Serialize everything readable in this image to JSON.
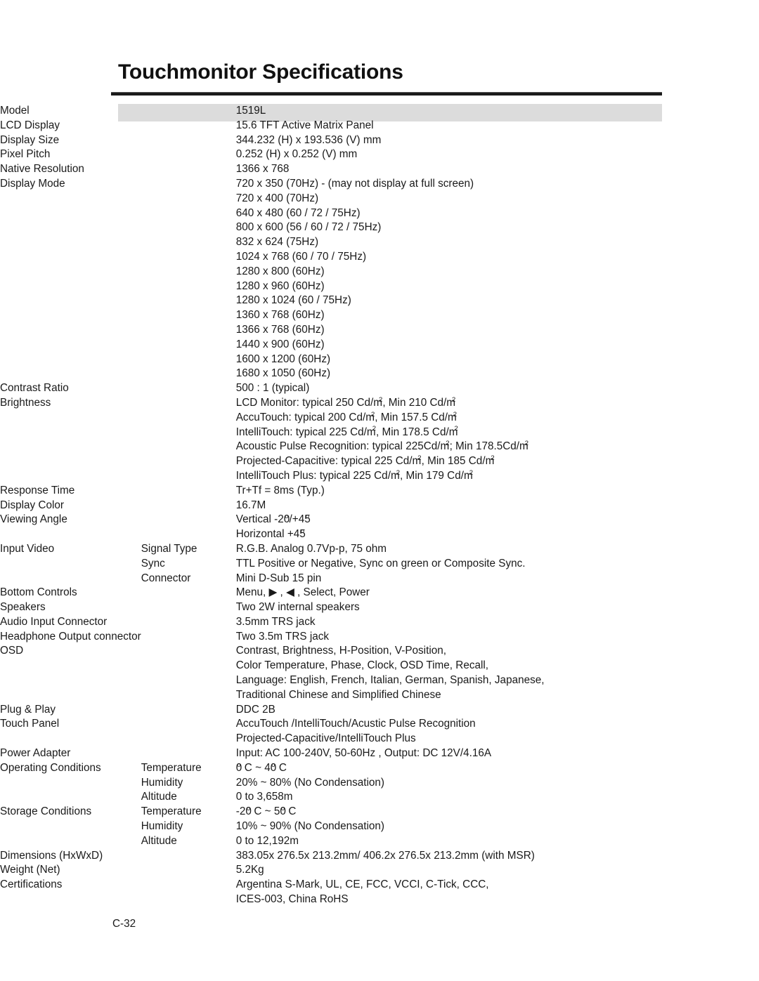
{
  "document": {
    "title": "Touchmonitor Specifications",
    "page_number": "C-32"
  },
  "table": {
    "header": {
      "label": "Model",
      "value": "1519L"
    },
    "rows": [
      {
        "label": "LCD  Display",
        "sub": "",
        "value": "15.6   TFT Active Matrix Panel"
      },
      {
        "label": "Display Size",
        "sub": "",
        "value": "344.232 (H)  x  193.536 (V) mm"
      },
      {
        "label": "Pixel Pitch",
        "sub": "",
        "value": "0.252 (H)  x  0.252 (V) mm"
      },
      {
        "label": "Native Resolution",
        "sub": "",
        "value": "1366 x 768"
      },
      {
        "label": "Display Mode",
        "sub": "",
        "value": "720 x 350 (70Hz) - (may not display at full screen)"
      },
      {
        "label": "",
        "sub": "",
        "value": "720 x 400 (70Hz)"
      },
      {
        "label": "",
        "sub": "",
        "value": "640 x 480 (60 / 72 / 75Hz)"
      },
      {
        "label": "",
        "sub": "",
        "value": "800 x 600 (56 / 60 / 72 / 75Hz)"
      },
      {
        "label": "",
        "sub": "",
        "value": "832 x 624 (75Hz)"
      },
      {
        "label": "",
        "sub": "",
        "value": "1024 x 768 (60 / 70 / 75Hz)"
      },
      {
        "label": "",
        "sub": "",
        "value": "1280 x 800 (60Hz)"
      },
      {
        "label": "",
        "sub": "",
        "value": "1280 x 960 (60Hz)"
      },
      {
        "label": "",
        "sub": "",
        "value": "1280 x 1024 (60 / 75Hz)"
      },
      {
        "label": "",
        "sub": "",
        "value": "1360 x 768 (60Hz)"
      },
      {
        "label": "",
        "sub": "",
        "value": "1366 x 768 (60Hz)"
      },
      {
        "label": "",
        "sub": "",
        "value": "1440 x 900 (60Hz)"
      },
      {
        "label": "",
        "sub": "",
        "value": "1600 x 1200 (60Hz)"
      },
      {
        "label": "",
        "sub": "",
        "value": "1680 x 1050 (60Hz)"
      },
      {
        "label": "Contrast Ratio",
        "sub": "",
        "value": "500 : 1 (typical)"
      },
      {
        "label": "Brightness",
        "sub": "",
        "value": "LCD Monitor: typical 250 Cd/m², Min 210 Cd/m²"
      },
      {
        "label": "",
        "sub": "",
        "value": "AccuTouch: typical 200 Cd/m², Min 157.5 Cd/m²"
      },
      {
        "label": "",
        "sub": "",
        "value": "IntelliTouch: typical 225 Cd/m², Min 178.5 Cd/m²"
      },
      {
        "label": "",
        "sub": "",
        "value": "Acoustic Pulse Recognition: typical 225Cd/m²; Min 178.5Cd/m²"
      },
      {
        "label": "",
        "sub": "",
        "value": "Projected-Capacitive: typical 225 Cd/m², Min 185 Cd/m²"
      },
      {
        "label": "",
        "sub": "",
        "value": "IntelliTouch Plus: typical 225 Cd/m², Min 179 Cd/m²"
      },
      {
        "label": "Response Time",
        "sub": "",
        "value": "Tr+Tf = 8ms (Typ.)"
      },
      {
        "label": "Display Color",
        "sub": "",
        "value": "16.7M"
      },
      {
        "label": "Viewing Angle",
        "sub": "",
        "value": "Vertical -20°/+45°"
      },
      {
        "label": "",
        "sub": "",
        "value": "Horizontal +45°"
      },
      {
        "label": "Input  Video",
        "sub": "Signal Type",
        "value": " R.G.B. Analog 0.7Vp-p, 75 ohm"
      },
      {
        "label": "",
        "sub": "Sync",
        "value": " TTL Positive or Negative, Sync on green or Composite Sync."
      },
      {
        "label": "",
        "sub": "Connector",
        "value": " Mini D-Sub 15 pin"
      },
      {
        "label": "Bottom  Controls",
        "sub": "",
        "value": "Menu, ▶ , ◀ , Select, Power"
      },
      {
        "label": "Speakers",
        "sub": "",
        "value": "Two 2W internal speakers"
      },
      {
        "label": "Audio Input Connector",
        "sub": "",
        "value": "3.5mm TRS jack"
      },
      {
        "label": "Headphone Output connector",
        "sub": "",
        "value": "Two 3.5m TRS jack"
      },
      {
        "label": "OSD",
        "sub": "",
        "value": "Contrast, Brightness, H-Position, V-Position,"
      },
      {
        "label": "",
        "sub": "",
        "value": "Color Temperature, Phase, Clock, OSD Time, Recall,"
      },
      {
        "label": "",
        "sub": "",
        "value": "Language: English, French, Italian, German, Spanish, Japanese,"
      },
      {
        "label": "",
        "sub": "",
        "value": "Traditional Chinese and Simplified Chinese"
      },
      {
        "label": "Plug & Play",
        "sub": "",
        "value": "DDC 2B"
      },
      {
        "label": "Touch Panel",
        "sub": "",
        "value": "AccuTouch /IntelliTouch/Acustic Pulse Recognition"
      },
      {
        "label": "",
        "sub": "",
        "value": "Projected-Capacitive/IntelliTouch Plus"
      },
      {
        "label": "Power Adapter",
        "sub": "",
        "value": "Input: AC 100-240V, 50-60Hz , Output: DC 12V/4.16A"
      },
      {
        "label": "Operating Conditions",
        "sub": "Temperature",
        "value": " 0° C ~ 40° C"
      },
      {
        "label": "",
        "sub": "Humidity",
        "value": "20% ~ 80% (No Condensation)"
      },
      {
        "label": "",
        "sub": "Altitude",
        "value": "0 to 3,658m"
      },
      {
        "label": "Storage Conditions",
        "sub": "Temperature",
        "value": " -20° C ~ 50° C"
      },
      {
        "label": "",
        "sub": "Humidity",
        "value": "10% ~ 90% (No Condensation)"
      },
      {
        "label": "",
        "sub": "Altitude",
        "value": "0 to 12,192m"
      },
      {
        "label": "Dimensions (HxWxD)",
        "sub": "",
        "value": "383.05x 276.5x 213.2mm/ 406.2x 276.5x 213.2mm (with MSR)"
      },
      {
        "label": "Weight (Net)",
        "sub": "",
        "value": "5.2Kg"
      },
      {
        "label": "Certifications",
        "sub": "",
        "value": "Argentina S-Mark,  UL, CE, FCC, VCCI, C-Tick, CCC,"
      },
      {
        "label": "",
        "sub": "",
        "value": "ICES-003, China RoHS"
      }
    ]
  },
  "colors": {
    "header_band": "#dcdcdc",
    "text": "#1a1a1a",
    "rule": "#1a1a1a"
  }
}
